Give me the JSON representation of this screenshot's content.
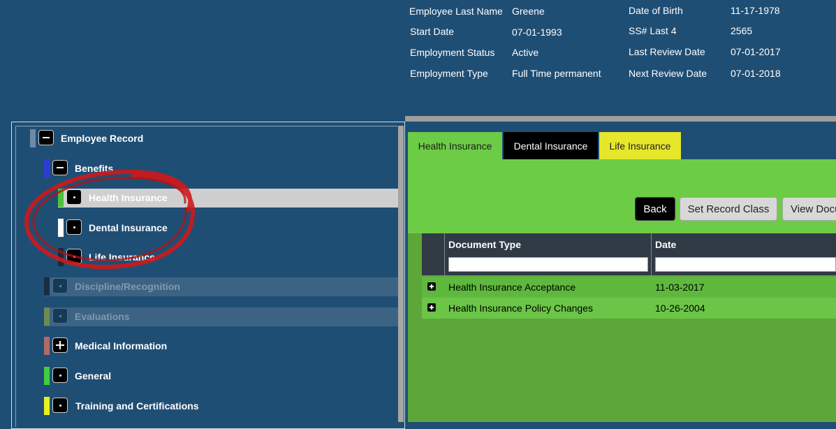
{
  "employee": {
    "last_name_label": "Employee Last Name",
    "last_name": "Greene",
    "start_date_label": "Start Date",
    "start_date": "07-01-1993",
    "status_label": "Employment Status",
    "status": "Active",
    "type_label": "Employment Type",
    "type": "Full Time permanent",
    "dob_label": "Date of Birth",
    "dob": "11-17-1978",
    "ssn_label": "SS# Last 4",
    "ssn": "2565",
    "last_review_label": "Last Review Date",
    "last_review": "07-01-2017",
    "next_review_label": "Next Review Date",
    "next_review": "07-01-2018"
  },
  "tree": {
    "root": "Employee Record",
    "benefits": "Benefits",
    "health": "Health Insurance",
    "dental": "Dental Insurance",
    "life": "Life Insurance",
    "discipline": "Discipline/Recognition",
    "evaluations": "Evaluations",
    "medical": "Medical Information",
    "general": "General",
    "training": "Training and Certifications"
  },
  "tabs": {
    "health": "Health Insurance",
    "dental": "Dental Insurance",
    "life": "Life Insurance"
  },
  "toolbar": {
    "back": "Back",
    "set_record_class": "Set Record Class",
    "view_docs": "View Docu"
  },
  "table": {
    "columns": [
      "Document Type",
      "Date"
    ],
    "rows": [
      {
        "type": "Health Insurance Acceptance",
        "date": "11-03-2017"
      },
      {
        "type": "Health Insurance Policy Changes",
        "date": "10-26-2004"
      }
    ]
  },
  "colors": {
    "background": "#1f4e74",
    "tab_active": "#6dcc46",
    "tab_dental": "#000000",
    "tab_life": "#e6e62a",
    "annotation": "#d01818"
  }
}
